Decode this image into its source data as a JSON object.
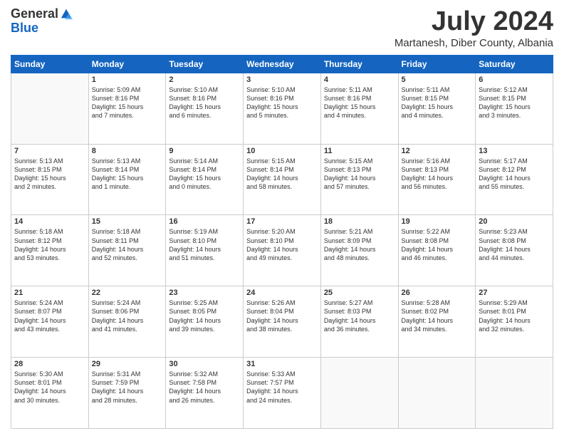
{
  "header": {
    "logo_general": "General",
    "logo_blue": "Blue",
    "month_title": "July 2024",
    "location": "Martanesh, Diber County, Albania"
  },
  "weekdays": [
    "Sunday",
    "Monday",
    "Tuesday",
    "Wednesday",
    "Thursday",
    "Friday",
    "Saturday"
  ],
  "weeks": [
    [
      {
        "day": "",
        "info": ""
      },
      {
        "day": "1",
        "info": "Sunrise: 5:09 AM\nSunset: 8:16 PM\nDaylight: 15 hours\nand 7 minutes."
      },
      {
        "day": "2",
        "info": "Sunrise: 5:10 AM\nSunset: 8:16 PM\nDaylight: 15 hours\nand 6 minutes."
      },
      {
        "day": "3",
        "info": "Sunrise: 5:10 AM\nSunset: 8:16 PM\nDaylight: 15 hours\nand 5 minutes."
      },
      {
        "day": "4",
        "info": "Sunrise: 5:11 AM\nSunset: 8:16 PM\nDaylight: 15 hours\nand 4 minutes."
      },
      {
        "day": "5",
        "info": "Sunrise: 5:11 AM\nSunset: 8:15 PM\nDaylight: 15 hours\nand 4 minutes."
      },
      {
        "day": "6",
        "info": "Sunrise: 5:12 AM\nSunset: 8:15 PM\nDaylight: 15 hours\nand 3 minutes."
      }
    ],
    [
      {
        "day": "7",
        "info": "Sunrise: 5:13 AM\nSunset: 8:15 PM\nDaylight: 15 hours\nand 2 minutes."
      },
      {
        "day": "8",
        "info": "Sunrise: 5:13 AM\nSunset: 8:14 PM\nDaylight: 15 hours\nand 1 minute."
      },
      {
        "day": "9",
        "info": "Sunrise: 5:14 AM\nSunset: 8:14 PM\nDaylight: 15 hours\nand 0 minutes."
      },
      {
        "day": "10",
        "info": "Sunrise: 5:15 AM\nSunset: 8:14 PM\nDaylight: 14 hours\nand 58 minutes."
      },
      {
        "day": "11",
        "info": "Sunrise: 5:15 AM\nSunset: 8:13 PM\nDaylight: 14 hours\nand 57 minutes."
      },
      {
        "day": "12",
        "info": "Sunrise: 5:16 AM\nSunset: 8:13 PM\nDaylight: 14 hours\nand 56 minutes."
      },
      {
        "day": "13",
        "info": "Sunrise: 5:17 AM\nSunset: 8:12 PM\nDaylight: 14 hours\nand 55 minutes."
      }
    ],
    [
      {
        "day": "14",
        "info": "Sunrise: 5:18 AM\nSunset: 8:12 PM\nDaylight: 14 hours\nand 53 minutes."
      },
      {
        "day": "15",
        "info": "Sunrise: 5:18 AM\nSunset: 8:11 PM\nDaylight: 14 hours\nand 52 minutes."
      },
      {
        "day": "16",
        "info": "Sunrise: 5:19 AM\nSunset: 8:10 PM\nDaylight: 14 hours\nand 51 minutes."
      },
      {
        "day": "17",
        "info": "Sunrise: 5:20 AM\nSunset: 8:10 PM\nDaylight: 14 hours\nand 49 minutes."
      },
      {
        "day": "18",
        "info": "Sunrise: 5:21 AM\nSunset: 8:09 PM\nDaylight: 14 hours\nand 48 minutes."
      },
      {
        "day": "19",
        "info": "Sunrise: 5:22 AM\nSunset: 8:08 PM\nDaylight: 14 hours\nand 46 minutes."
      },
      {
        "day": "20",
        "info": "Sunrise: 5:23 AM\nSunset: 8:08 PM\nDaylight: 14 hours\nand 44 minutes."
      }
    ],
    [
      {
        "day": "21",
        "info": "Sunrise: 5:24 AM\nSunset: 8:07 PM\nDaylight: 14 hours\nand 43 minutes."
      },
      {
        "day": "22",
        "info": "Sunrise: 5:24 AM\nSunset: 8:06 PM\nDaylight: 14 hours\nand 41 minutes."
      },
      {
        "day": "23",
        "info": "Sunrise: 5:25 AM\nSunset: 8:05 PM\nDaylight: 14 hours\nand 39 minutes."
      },
      {
        "day": "24",
        "info": "Sunrise: 5:26 AM\nSunset: 8:04 PM\nDaylight: 14 hours\nand 38 minutes."
      },
      {
        "day": "25",
        "info": "Sunrise: 5:27 AM\nSunset: 8:03 PM\nDaylight: 14 hours\nand 36 minutes."
      },
      {
        "day": "26",
        "info": "Sunrise: 5:28 AM\nSunset: 8:02 PM\nDaylight: 14 hours\nand 34 minutes."
      },
      {
        "day": "27",
        "info": "Sunrise: 5:29 AM\nSunset: 8:01 PM\nDaylight: 14 hours\nand 32 minutes."
      }
    ],
    [
      {
        "day": "28",
        "info": "Sunrise: 5:30 AM\nSunset: 8:01 PM\nDaylight: 14 hours\nand 30 minutes."
      },
      {
        "day": "29",
        "info": "Sunrise: 5:31 AM\nSunset: 7:59 PM\nDaylight: 14 hours\nand 28 minutes."
      },
      {
        "day": "30",
        "info": "Sunrise: 5:32 AM\nSunset: 7:58 PM\nDaylight: 14 hours\nand 26 minutes."
      },
      {
        "day": "31",
        "info": "Sunrise: 5:33 AM\nSunset: 7:57 PM\nDaylight: 14 hours\nand 24 minutes."
      },
      {
        "day": "",
        "info": ""
      },
      {
        "day": "",
        "info": ""
      },
      {
        "day": "",
        "info": ""
      }
    ]
  ]
}
